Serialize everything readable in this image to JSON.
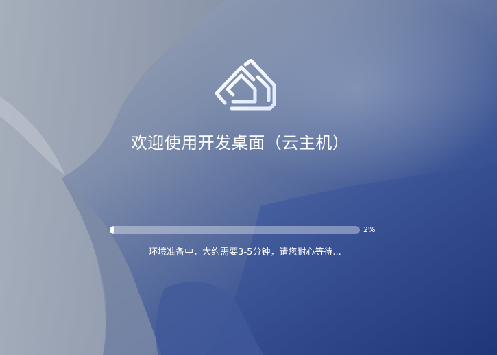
{
  "welcome": {
    "title": "欢迎使用开发桌面（云主机）"
  },
  "progress": {
    "value": 0.02,
    "percent_label": "2%",
    "status_text": "环境准备中，大约需要3-5分钟，请您耐心等待..."
  },
  "icons": {
    "logo": "home-logo-icon"
  },
  "colors": {
    "text": "#ffffff",
    "track": "#ffffff5c",
    "fill": "#ffffff",
    "bg_deep_blue": "#24408a",
    "bg_grey": "#a3acb8"
  }
}
